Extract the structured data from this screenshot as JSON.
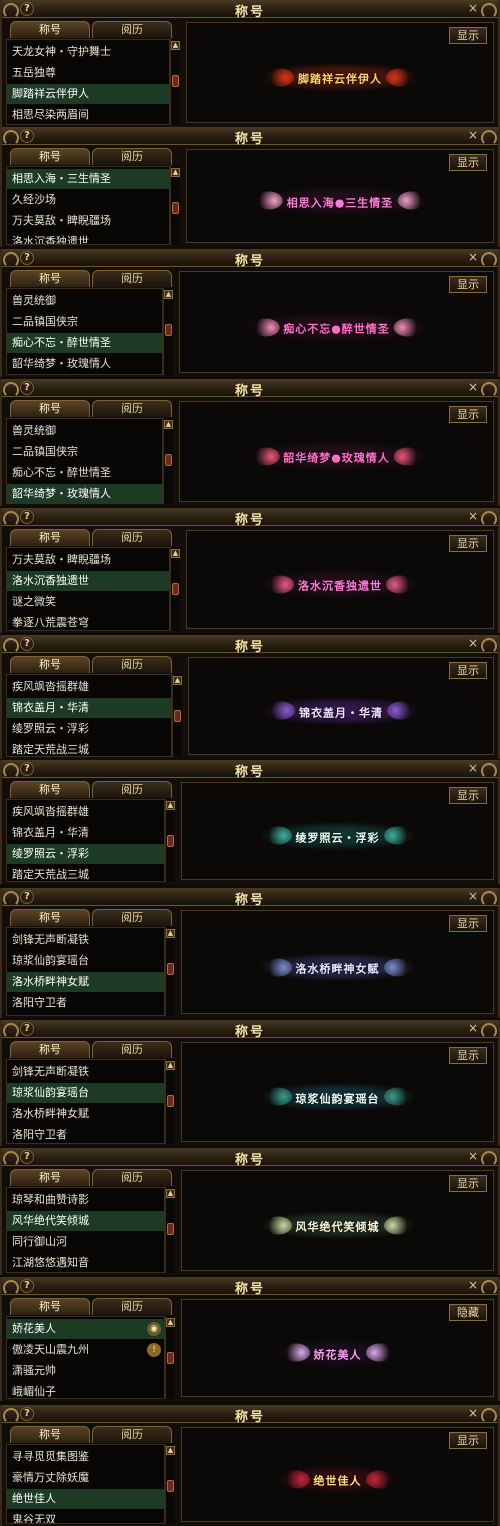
{
  "screenshot": {
    "tab_title": "称号",
    "tab_history": "阅历",
    "help_glyph": "?",
    "close_glyph": "×",
    "scroll_up_glyph": "▲"
  },
  "panels": [
    {
      "title": "称号",
      "items": [
        "天龙女神・守护舞士",
        "五岳独尊",
        "脚踏祥云伴伊人",
        "相思尽染两眉间"
      ],
      "selected_index": 2,
      "button": "显示",
      "emblem_text": "脚踏祥云伴伊人",
      "emblem_color": "#ffd36a",
      "emblem_bg": "#5a1a0a",
      "wing_color": "#d8361a"
    },
    {
      "title": "称号",
      "items": [
        "相思入海・三生情圣",
        "久经沙场",
        "万夫莫敌・睥睨疆场",
        "洛水沉香独遗世"
      ],
      "selected_index": 0,
      "button": "显示",
      "emblem_text": "相思入海●三生情圣",
      "emblem_color": "#ff7ad9",
      "emblem_bg": "#2a0f22",
      "wing_color": "#f2a0c8"
    },
    {
      "title": "称号",
      "items": [
        "兽灵统御",
        "二品镇国侠宗",
        "痴心不忘・醉世情圣",
        "韶华绮梦・玫瑰情人"
      ],
      "selected_index": 2,
      "button": "显示",
      "emblem_text": "痴心不忘●醉世情圣",
      "emblem_color": "#ff6ec7",
      "emblem_bg": "#2a0f22",
      "wing_color": "#f08cb6"
    },
    {
      "title": "称号",
      "items": [
        "兽灵统御",
        "二品镇国侠宗",
        "痴心不忘・醉世情圣",
        "韶华绮梦・玫瑰情人"
      ],
      "selected_index": 3,
      "button": "显示",
      "emblem_text": "韶华绮梦●玫瑰情人",
      "emblem_color": "#ff6ec7",
      "emblem_bg": "#2a0f22",
      "wing_color": "#ee5577"
    },
    {
      "title": "称号",
      "items": [
        "万夫莫敌・睥睨疆场",
        "洛水沉香独遗世",
        "谜之微笑",
        "拳逐八荒震苍穹"
      ],
      "selected_index": 1,
      "button": "显示",
      "emblem_text": "洛水沉香独遗世",
      "emblem_color": "#ff7ad9",
      "emblem_bg": "#2a0f22",
      "wing_color": "#e85a8a"
    },
    {
      "title": "称号",
      "items": [
        "疾风飒沓摇群雄",
        "锦衣盖月・华清",
        "绫罗照云・浮彩",
        "踏定天荒战三城"
      ],
      "selected_index": 1,
      "button": "显示",
      "emblem_text": "锦衣盖月・华清",
      "emblem_color": "#f4e4ff",
      "emblem_bg": "#3b1b5a",
      "wing_color": "#8a5ad0"
    },
    {
      "title": "称号",
      "items": [
        "疾风飒沓摇群雄",
        "锦衣盖月・华清",
        "绫罗照云・浮彩",
        "踏定天荒战三城"
      ],
      "selected_index": 2,
      "button": "显示",
      "emblem_text": "绫罗照云・浮彩",
      "emblem_color": "#e8fff4",
      "emblem_bg": "#123b3a",
      "wing_color": "#3fae9a"
    },
    {
      "title": "称号",
      "items": [
        "剑锋无声断凝铁",
        "琼浆仙韵宴瑶台",
        "洛水桥畔神女赋",
        "洛阳守卫者"
      ],
      "selected_index": 2,
      "button": "显示",
      "emblem_text": "洛水桥畔神女赋",
      "emblem_color": "#e6e8ff",
      "emblem_bg": "#2b2f5a",
      "wing_color": "#7a8acc"
    },
    {
      "title": "称号",
      "items": [
        "剑锋无声断凝铁",
        "琼浆仙韵宴瑶台",
        "洛水桥畔神女赋",
        "洛阳守卫者"
      ],
      "selected_index": 1,
      "button": "显示",
      "emblem_text": "琼浆仙韵宴瑶台",
      "emblem_color": "#f0fff4",
      "emblem_bg": "#163a48",
      "wing_color": "#3a9a88"
    },
    {
      "title": "称号",
      "items": [
        "琼琴和曲赞诗影",
        "风华绝代笑倾城",
        "同行御山河",
        "江湖悠悠遇知音"
      ],
      "selected_index": 1,
      "button": "显示",
      "emblem_text": "风华绝代笑倾城",
      "emblem_color": "#fff6dc",
      "emblem_bg": "#263a28",
      "wing_color": "#c8d8a0"
    },
    {
      "title": "称号",
      "items": [
        "娇花美人",
        "傲凌天山震九州",
        "潇骚元帅",
        "峨嵋仙子"
      ],
      "selected_index": 0,
      "button": "隐藏",
      "emblem_text": "娇花美人",
      "emblem_color": "#ff9bf0",
      "emblem_bg": "#1e1024",
      "wing_color": "#d8a8e8"
    },
    {
      "title": "称号",
      "items": [
        "寻寻觅觅集图鉴",
        "豪情万丈除妖魔",
        "绝世佳人",
        "鬼谷无双"
      ],
      "selected_index": 2,
      "button": "显示",
      "emblem_text": "绝世佳人",
      "emblem_color": "#ffe07a",
      "emblem_bg": "#3a0a12",
      "wing_color": "#c8263a"
    }
  ]
}
